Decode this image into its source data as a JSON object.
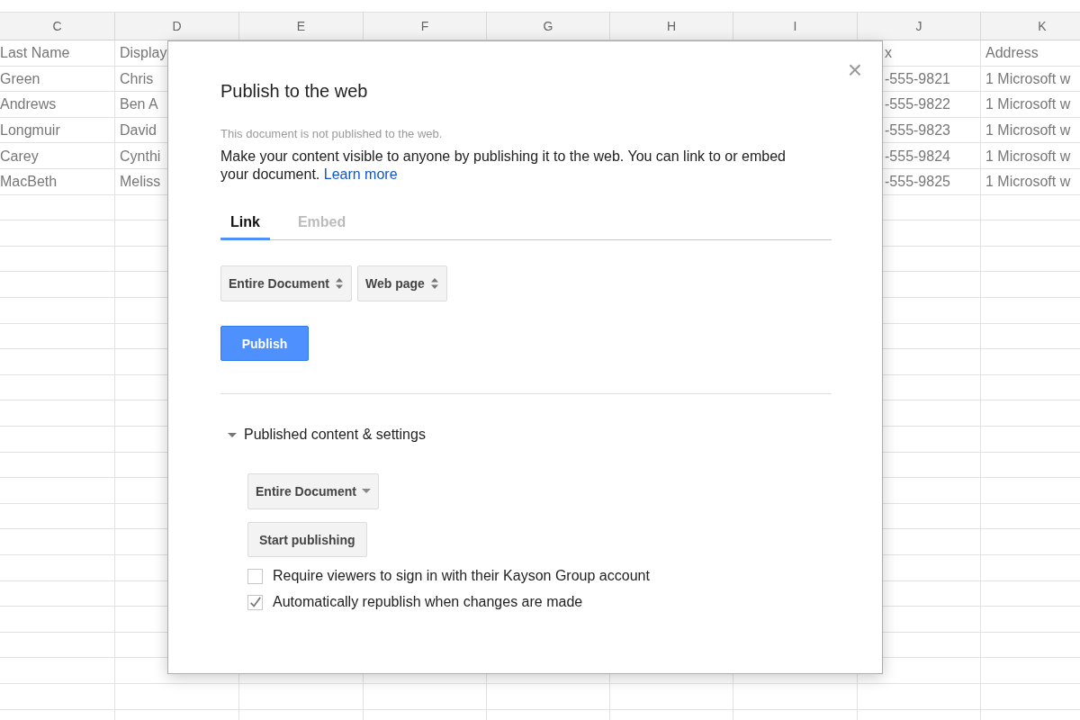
{
  "spreadsheet": {
    "column_headers": [
      "C",
      "D",
      "E",
      "F",
      "G",
      "H",
      "I",
      "J",
      "K"
    ],
    "rows": [
      {
        "C": "Last Name",
        "D": "Display",
        "J": "x",
        "K": "Address"
      },
      {
        "C": "Green",
        "D": "Chris",
        "J": "-555-9821",
        "K": "1 Microsoft w"
      },
      {
        "C": "Andrews",
        "D": "Ben A",
        "J": "-555-9822",
        "K": "1 Microsoft w"
      },
      {
        "C": "Longmuir",
        "D": "David",
        "J": "-555-9823",
        "K": "1 Microsoft w"
      },
      {
        "C": "Carey",
        "D": "Cynthi",
        "J": "-555-9824",
        "K": "1 Microsoft w"
      },
      {
        "C": "MacBeth",
        "D": "Meliss",
        "J": "-555-9825",
        "K": "1 Microsoft w"
      }
    ]
  },
  "dialog": {
    "title": "Publish to the web",
    "close": "×",
    "status": "This document is not published to the web.",
    "description": "Make your content visible to anyone by publishing it to the web. You can link to or embed your document.",
    "learn_more": "Learn more",
    "tabs": [
      {
        "label": "Link",
        "selected": true
      },
      {
        "label": "Embed",
        "selected": false
      }
    ],
    "selects": [
      {
        "label": "Entire Document"
      },
      {
        "label": "Web page"
      }
    ],
    "publish_button": "Publish",
    "section": {
      "label": "Published content & settings",
      "expanded": true
    },
    "settings_select": "Entire Document",
    "start_button": "Start publishing",
    "checkboxes": [
      {
        "label": "Require viewers to sign in with their Kayson Group account",
        "checked": false
      },
      {
        "label": "Automatically republish when changes are made",
        "checked": true
      }
    ]
  }
}
